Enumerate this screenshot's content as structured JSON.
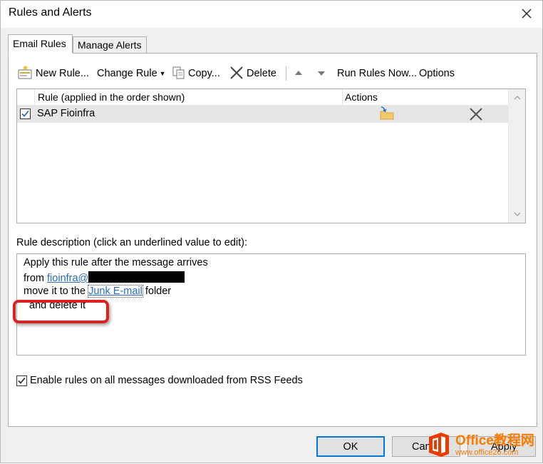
{
  "window": {
    "title": "Rules and Alerts"
  },
  "tabs": [
    {
      "label": "Email Rules",
      "active": true
    },
    {
      "label": "Manage Alerts",
      "active": false
    }
  ],
  "toolbar": {
    "new_rule": "New Rule...",
    "change_rule": "Change Rule",
    "copy": "Copy...",
    "delete": "Delete",
    "run_rules_now": "Run Rules Now...",
    "options": "Options"
  },
  "rules_list": {
    "columns": {
      "rule": "Rule (applied in the order shown)",
      "actions": "Actions"
    },
    "rows": [
      {
        "name": "SAP Fioinfra",
        "enabled": true
      }
    ]
  },
  "description": {
    "label": "Rule description (click an underlined value to edit):",
    "line1": "Apply this rule after the message arrives",
    "line2_prefix": "from ",
    "line2_link": "fioinfra@",
    "line3_prefix": "move it to the ",
    "line3_link": "Junk E-mail",
    "line3_suffix": " folder",
    "line4": "and delete it"
  },
  "rss_option": {
    "label": "Enable rules on all messages downloaded from RSS Feeds",
    "checked": true
  },
  "buttons": {
    "ok": "OK",
    "cancel": "Can",
    "apply": "Apply"
  },
  "watermark": {
    "line1": "Office教程网",
    "line2": "www.office26.com"
  },
  "colors": {
    "accent": "#0078d7",
    "link": "#2b6cb8",
    "highlight": "#e02020",
    "watermark": "#f57c00"
  }
}
